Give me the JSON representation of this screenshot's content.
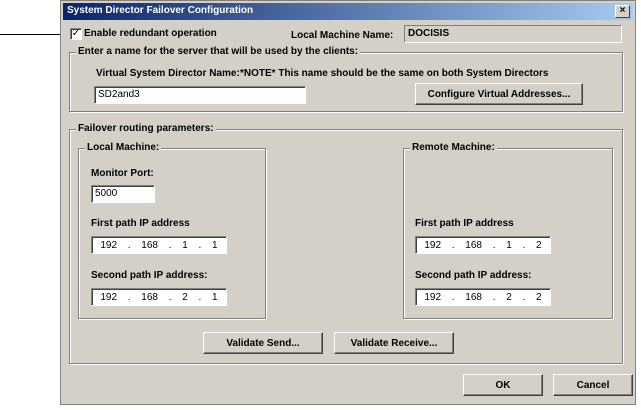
{
  "window": {
    "title": "System Director Failover Configuration",
    "close_glyph": "×"
  },
  "enable": {
    "label": "Enable redundant operation",
    "checked": "✓"
  },
  "local_machine_name": {
    "label": "Local Machine Name:",
    "value": "DOCISIS"
  },
  "server_group": {
    "legend": "Enter a name for the server that will be used by the clients:",
    "vsd_label": "Virtual System Director Name:",
    "note": "*NOTE* This name should be the same on both System Directors",
    "vsd_value": "SD2and3",
    "configure_button": "Configure Virtual Addresses..."
  },
  "failover_group": {
    "legend": "Failover routing parameters:",
    "local": {
      "legend": "Local Machine:",
      "monitor_port_label": "Monitor Port:",
      "monitor_port_value": "5000",
      "first_ip_label": "First path IP address",
      "first_ip": [
        "192",
        "168",
        "1",
        "1"
      ],
      "second_ip_label": "Second path IP address:",
      "second_ip": [
        "192",
        "168",
        "2",
        "1"
      ]
    },
    "remote": {
      "legend": "Remote Machine:",
      "first_ip_label": "First path  IP address",
      "first_ip": [
        "192",
        "168",
        "1",
        "2"
      ],
      "second_ip_label": "Second path IP address:",
      "second_ip": [
        "192",
        "168",
        "2",
        "2"
      ]
    }
  },
  "buttons": {
    "validate_send": "Validate Send...",
    "validate_receive": "Validate Receive...",
    "ok": "OK",
    "cancel": "Cancel"
  },
  "ip_separator": "."
}
